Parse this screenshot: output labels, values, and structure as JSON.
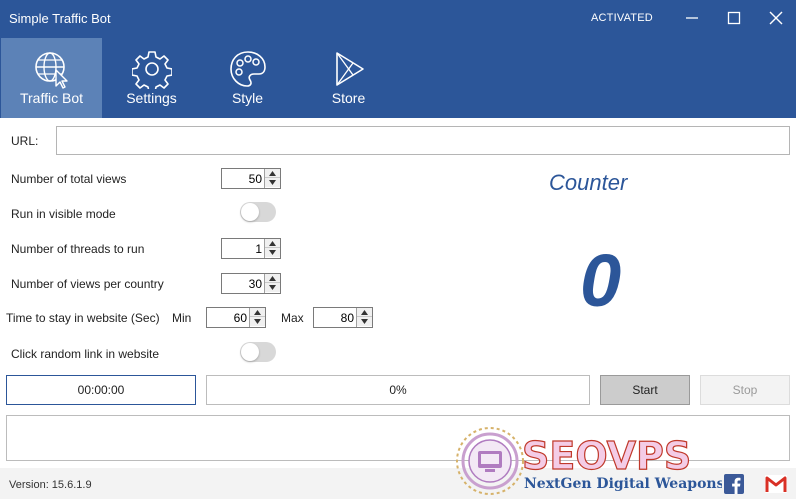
{
  "app": {
    "title": "Simple Traffic Bot",
    "status": "ACTIVATED",
    "accent_color": "#2c5699",
    "active_tab_color": "#5c82b7"
  },
  "window_controls": {
    "minimize_icon": "minimize-icon",
    "maximize_icon": "maximize-icon",
    "close_icon": "close-icon"
  },
  "nav": {
    "tabs": [
      {
        "label": "Traffic Bot",
        "icon": "globe-cursor-icon",
        "active": true
      },
      {
        "label": "Settings",
        "icon": "gear-icon",
        "active": false
      },
      {
        "label": "Style",
        "icon": "palette-icon",
        "active": false
      },
      {
        "label": "Store",
        "icon": "store-play-icon",
        "active": false
      }
    ]
  },
  "form": {
    "url_label": "URL:",
    "url_value": "",
    "total_views_label": "Number of total views",
    "total_views_value": "50",
    "visible_mode_label": "Run in visible mode",
    "visible_mode_on": false,
    "threads_label": "Number of threads to run",
    "threads_value": "1",
    "views_per_country_label": "Number of views per country",
    "views_per_country_value": "30",
    "time_label": "Time to stay in website (Sec)",
    "min_label": "Min",
    "min_value": "60",
    "max_label": "Max",
    "max_value": "80",
    "random_link_label": "Click random link in website",
    "random_link_on": false
  },
  "counter": {
    "title": "Counter",
    "value": "0"
  },
  "status_bar": {
    "timer": "00:00:00",
    "progress_label": "0%",
    "progress_fraction": 0,
    "start_label": "Start",
    "stop_label": "Stop"
  },
  "log": {
    "text": ""
  },
  "footer": {
    "version": "Version: 15.6.1.9",
    "logo_text": "SEOVPS",
    "logo_tagline": "NextGen Digital Weapons",
    "facebook_icon": "facebook-icon",
    "gmail_icon": "gmail-icon"
  }
}
